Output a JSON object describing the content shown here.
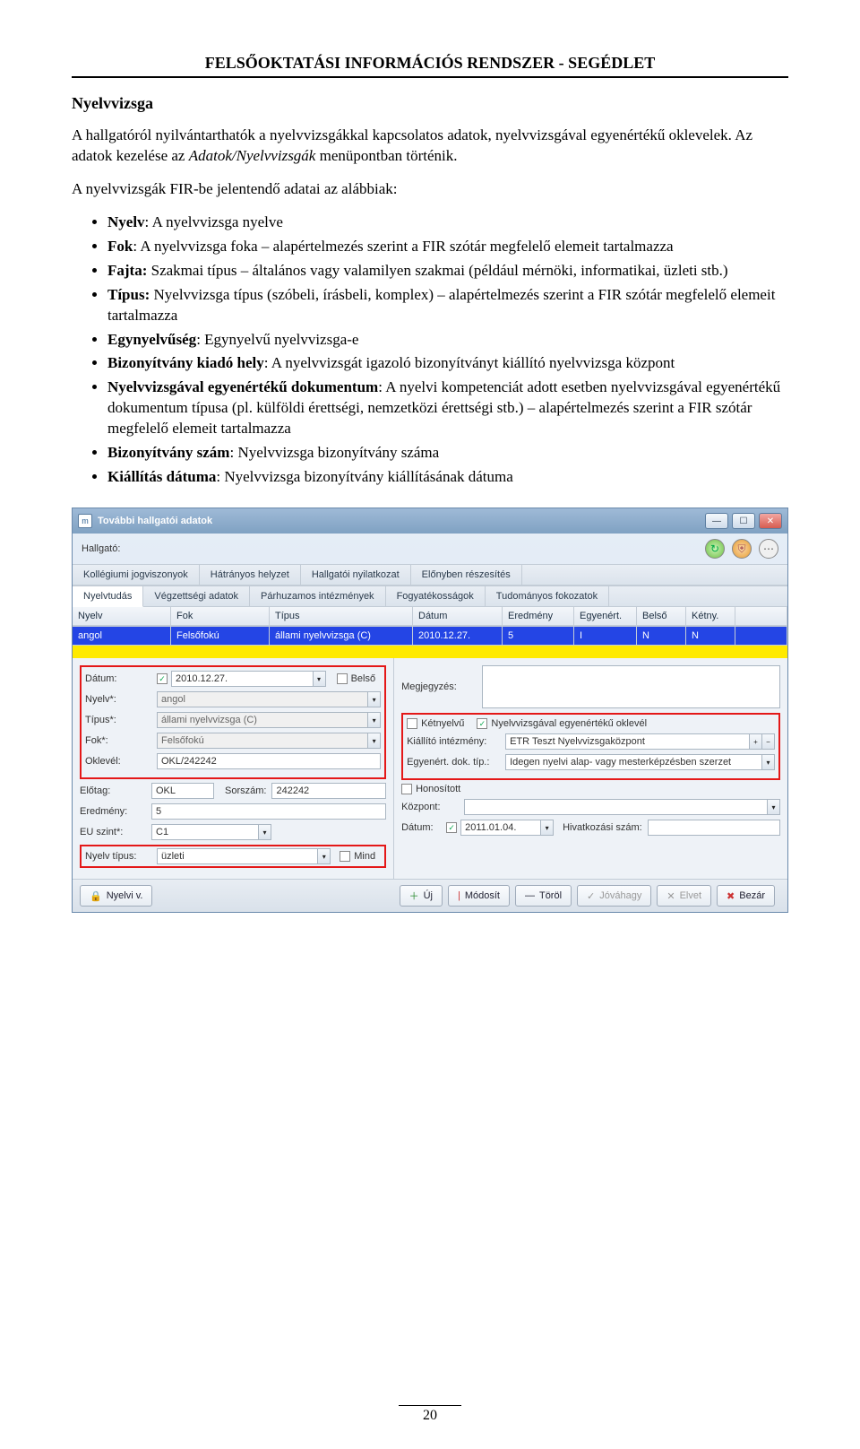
{
  "header": "FELSŐOKTATÁSI INFORMÁCIÓS RENDSZER -  SEGÉDLET",
  "section": "Nyelvvizsga",
  "para1": "A hallgatóról nyilvántarthatók a nyelvvizsgákkal kapcsolatos adatok, nyelvvizsgával egyenértékű oklevelek. Az adatok kezelése az ",
  "para1_em": "Adatok/Nyelvvizsgák",
  "para1_end": " menüpontban történik.",
  "para2": "A nyelvvizsgák FIR-be jelentendő adatai az alábbiak:",
  "bullets": [
    {
      "b": "Nyelv",
      "t": ": A nyelvvizsga nyelve"
    },
    {
      "b": "Fok",
      "t": ": A nyelvvizsga foka – alapértelmezés szerint a FIR szótár megfelelő elemeit tartalmazza"
    },
    {
      "b": "Fajta:",
      "t": " Szakmai típus – általános vagy valamilyen szakmai (például mérnöki, informatikai, üzleti stb.)"
    },
    {
      "b": "Típus:",
      "t": " Nyelvvizsga típus (szóbeli, írásbeli, komplex) – alapértelmezés szerint a FIR szótár megfelelő elemeit tartalmazza"
    },
    {
      "b": "Egynyelvűség",
      "t": ": Egynyelvű nyelvvizsga-e"
    },
    {
      "b": "Bizonyítvány kiadó hely",
      "t": ": A nyelvvizsgát igazoló bizonyítványt kiállító nyelvvizsga központ"
    },
    {
      "b": "Nyelvvizsgával egyenértékű dokumentum",
      "t": ": A nyelvi kompetenciát adott esetben nyelvvizsgával egyenértékű dokumentum típusa (pl. külföldi érettségi, nemzetközi érettségi stb.) – alapértelmezés szerint a FIR szótár megfelelő elemeit tartalmazza"
    },
    {
      "b": "Bizonyítvány szám",
      "t": ": Nyelvvizsga bizonyítvány száma"
    },
    {
      "b": "Kiállítás dátuma",
      "t": ": Nyelvvizsga bizonyítvány kiállításának dátuma"
    }
  ],
  "win": {
    "title": "További hallgatói adatok",
    "hallgato_lbl": "Hallgató:",
    "tabs1": [
      "Kollégiumi jogviszonyok",
      "Hátrányos helyzet",
      "Hallgatói nyilatkozat",
      "Előnyben részesítés"
    ],
    "tabs2": [
      "Nyelvtudás",
      "Végzettségi adatok",
      "Párhuzamos intézmények",
      "Fogyatékosságok",
      "Tudományos fokozatok"
    ],
    "cols": [
      "Nyelv",
      "Fok",
      "Típus",
      "Dátum",
      "Eredmény",
      "Egyenért.",
      "Belső",
      "Kétny.",
      ""
    ],
    "row": [
      "angol",
      "Felsőfokú",
      "állami nyelvvizsga (C)",
      "2010.12.27.",
      "5",
      "I",
      "N",
      "N",
      ""
    ],
    "left": {
      "datum_lbl": "Dátum:",
      "datum": "2010.12.27.",
      "belso": "Belső",
      "nyelv_lbl": "Nyelv*:",
      "nyelv": "angol",
      "tipus_lbl": "Típus*:",
      "tipus": "állami nyelvvizsga (C)",
      "fok_lbl": "Fok*:",
      "fok": "Felsőfokú",
      "oklevel_lbl": "Oklevél:",
      "oklevel": "OKL/242242",
      "elotag_lbl": "Előtag:",
      "elotag": "OKL",
      "sorszam_lbl": "Sorszám:",
      "sorszam": "242242",
      "eredmeny_lbl": "Eredmény:",
      "eredmeny": "5",
      "euszint_lbl": "EU szint*:",
      "euszint": "C1",
      "nyelvtipus_lbl": "Nyelv típus:",
      "nyelvtipus": "üzleti",
      "mind": "Mind"
    },
    "right": {
      "megjegyzes_lbl": "Megjegyzés:",
      "ketnyelu": "Kétnyelvű",
      "egyenert_chk": "Nyelvvizsgával egyenértékű oklevél",
      "kiallito_lbl": "Kiállító intézmény:",
      "kiallito": "ETR Teszt Nyelvvizsgaközpont",
      "egyenert_lbl": "Egyenért. dok. típ.:",
      "egyenert": "Idegen nyelvi alap- vagy mesterképzésben szerzet",
      "honositott": "Honosított",
      "kozpont_lbl": "Központ:",
      "datum2_lbl": "Dátum:",
      "datum2": "2011.01.04.",
      "hivatkozas_lbl": "Hivatkozási szám:"
    },
    "buttons": {
      "nyelviv": "Nyelvi v.",
      "uj": "Új",
      "modosit": "Módosít",
      "torol": "Töröl",
      "jovahagy": "Jóváhagy",
      "elvet": "Elvet",
      "bezar": "Bezár"
    }
  },
  "pagenum": "20"
}
